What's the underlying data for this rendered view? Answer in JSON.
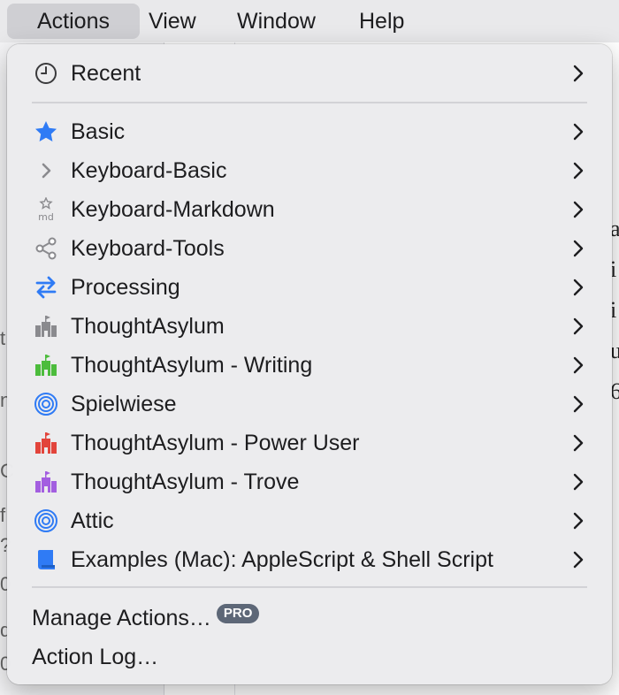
{
  "menubar": {
    "items": [
      {
        "label": "Actions",
        "active": true
      },
      {
        "label": "View"
      },
      {
        "label": "Window"
      },
      {
        "label": "Help"
      }
    ]
  },
  "menu": {
    "recent": {
      "label": "Recent",
      "icon": "clock-icon"
    },
    "groups": [
      {
        "label": "Basic",
        "icon": "star-icon",
        "color": "#2f7bf5"
      },
      {
        "label": "Keyboard-Basic",
        "icon": "chevron-right-icon",
        "color": "#8a8a8e"
      },
      {
        "label": "Keyboard-Markdown",
        "icon": "star-md-icon",
        "color": "#8a8a8e"
      },
      {
        "label": "Keyboard-Tools",
        "icon": "share-icon",
        "color": "#8a8a8e"
      },
      {
        "label": "Processing",
        "icon": "swap-arrows-icon",
        "color": "#2f7bf5"
      },
      {
        "label": "ThoughtAsylum",
        "icon": "castle-icon",
        "color": "#8a8a8e"
      },
      {
        "label": "ThoughtAsylum - Writing",
        "icon": "castle-icon",
        "color": "#4cbc3c"
      },
      {
        "label": "Spielwiese",
        "icon": "target-icon",
        "color": "#2f7bf5"
      },
      {
        "label": "ThoughtAsylum - Power User",
        "icon": "castle-icon",
        "color": "#e2443b"
      },
      {
        "label": "ThoughtAsylum - Trove",
        "icon": "castle-icon",
        "color": "#a35ee0"
      },
      {
        "label": "Attic",
        "icon": "target-icon",
        "color": "#2f7bf5"
      },
      {
        "label": "Examples (Mac): AppleScript & Shell Script",
        "icon": "scroll-icon",
        "color": "#2f7bf5"
      }
    ],
    "manage": {
      "label": "Manage Actions…",
      "badge": "PRO"
    },
    "log": {
      "label": "Action Log…"
    }
  },
  "background": {
    "right_fragments": [
      "a",
      "i",
      "i",
      "u",
      "6"
    ],
    "left_fragments": [
      "t",
      "n",
      "C",
      "f",
      "?",
      "0",
      "d",
      "0"
    ]
  }
}
